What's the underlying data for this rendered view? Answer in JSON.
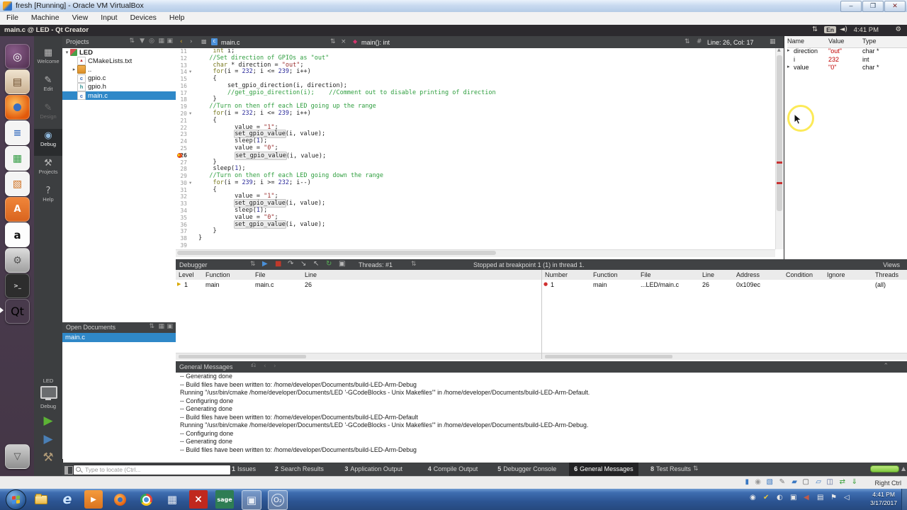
{
  "host": {
    "title": "fresh [Running] - Oracle VM VirtualBox",
    "menu": [
      "File",
      "Machine",
      "View",
      "Input",
      "Devices",
      "Help"
    ],
    "window_buttons": [
      "minimize",
      "maximize",
      "close"
    ],
    "status_shortcut": "Right Ctrl",
    "status_icons": [
      "hdd",
      "optical-disk",
      "audio",
      "pen",
      "shared-folder",
      "display",
      "folders",
      "usb",
      "network-arrows",
      "download"
    ],
    "taskbar": {
      "clock_time": "4:41 PM",
      "clock_date": "3/17/2017",
      "icons": [
        {
          "name": "explorer"
        },
        {
          "name": "internet-explorer",
          "glyph": "e"
        },
        {
          "name": "media-player",
          "glyph": "▶"
        },
        {
          "name": "firefox"
        },
        {
          "name": "chrome"
        },
        {
          "name": "calculator",
          "glyph": "▦"
        },
        {
          "name": "x-app",
          "glyph": "×"
        },
        {
          "name": "sage",
          "label": "sage"
        },
        {
          "name": "virtualbox",
          "glyph": "▣",
          "active": true
        },
        {
          "name": "o2-app",
          "label": "O₂",
          "active": true
        }
      ],
      "tray": [
        {
          "name": "bluetooth",
          "glyph": "◉"
        },
        {
          "name": "security-shield",
          "glyph": "✔"
        },
        {
          "name": "updates",
          "glyph": "◐"
        },
        {
          "name": "display",
          "glyph": "▣"
        },
        {
          "name": "audio-device",
          "glyph": "◀"
        },
        {
          "name": "network",
          "glyph": "▤"
        },
        {
          "name": "action-center-flag",
          "glyph": "⚑"
        },
        {
          "name": "volume",
          "glyph": "◁"
        }
      ]
    }
  },
  "guest_panel": {
    "title": "main.c @ LED - Qt Creator",
    "keyboard": "En",
    "time": "4:41 PM",
    "icons": [
      "network-arrows",
      "keyboard-layout",
      "volume",
      "clock",
      "session-gear"
    ]
  },
  "launcher": {
    "items": [
      {
        "name": "dash",
        "glyph": "◎"
      },
      {
        "name": "files",
        "glyph": "▤"
      },
      {
        "name": "firefox",
        "glyph": ""
      },
      {
        "name": "writer",
        "glyph": "≡"
      },
      {
        "name": "calc",
        "glyph": "▦"
      },
      {
        "name": "impress",
        "glyph": "▧"
      },
      {
        "name": "software",
        "glyph": "A"
      },
      {
        "name": "amazon",
        "glyph": "a"
      },
      {
        "name": "settings",
        "glyph": "⚙"
      },
      {
        "name": "terminal",
        "glyph": ">_"
      },
      {
        "name": "qtcreator",
        "glyph": "Qt",
        "running": true
      },
      {
        "name": "trash",
        "glyph": "▽"
      }
    ]
  },
  "modebar": {
    "items": [
      {
        "label": "Welcome",
        "icon": "▦"
      },
      {
        "label": "Edit",
        "icon": "✎"
      },
      {
        "label": "Design",
        "icon": "✎",
        "disabled": true
      },
      {
        "label": "Debug",
        "icon": "◉",
        "active": true
      },
      {
        "label": "Projects",
        "icon": "⚒"
      },
      {
        "label": "Help",
        "icon": "?"
      }
    ],
    "kit": {
      "project": "LED",
      "config": "Debug"
    },
    "run_buttons": [
      {
        "name": "run",
        "glyph": "▶",
        "color": "#5cb335"
      },
      {
        "name": "start-debugging",
        "glyph": "▶",
        "color": "#4a7fb5"
      },
      {
        "name": "build",
        "glyph": "⚒",
        "color": "#b09a77"
      }
    ]
  },
  "projects": {
    "header": "Projects",
    "header_icons": [
      "combo-arrows",
      "filter",
      "link",
      "split",
      "close-split"
    ],
    "tree": [
      {
        "label": "LED",
        "depth": 0,
        "icon": "project",
        "bold": true,
        "expander": "▾"
      },
      {
        "label": "CMakeLists.txt",
        "depth": 1,
        "icon": "doc"
      },
      {
        "label": "..",
        "depth": 1,
        "icon": "folder",
        "expander": "▸"
      },
      {
        "label": "gpio.c",
        "depth": 1,
        "icon": "c"
      },
      {
        "label": "gpio.h",
        "depth": 1,
        "icon": "h"
      },
      {
        "label": "main.c",
        "depth": 1,
        "icon": "c",
        "selected": true
      }
    ]
  },
  "open_documents": {
    "header": "Open Documents",
    "header_icons": [
      "combo-arrows",
      "split",
      "close-split"
    ],
    "items": [
      {
        "label": "main.c",
        "selected": true
      }
    ]
  },
  "editor": {
    "breadcrumb": {
      "back": "‹",
      "forward": "›",
      "file": "main.c",
      "symbol": "main(): int",
      "line_col": "Line: 26, Col: 17"
    },
    "breakpoint_line": 26,
    "lines": [
      {
        "n": 11,
        "segs": [
          [
            "p",
            "    "
          ],
          [
            "k",
            "int"
          ],
          [
            "p",
            " i;"
          ]
        ]
      },
      {
        "n": 12,
        "segs": [
          [
            "p",
            "   "
          ],
          [
            "c",
            "//Set direction of GPIOs as \"out\""
          ]
        ]
      },
      {
        "n": 13,
        "segs": [
          [
            "p",
            "    "
          ],
          [
            "k",
            "char"
          ],
          [
            "p",
            " * direction = "
          ],
          [
            "s",
            "\"out\""
          ],
          [
            "p",
            ";"
          ]
        ]
      },
      {
        "n": 14,
        "fold": true,
        "segs": [
          [
            "p",
            "    "
          ],
          [
            "k",
            "for"
          ],
          [
            "p",
            "(i = "
          ],
          [
            "n2",
            "232"
          ],
          [
            "p",
            "; i <= "
          ],
          [
            "n2",
            "239"
          ],
          [
            "p",
            "; i++)"
          ]
        ]
      },
      {
        "n": 15,
        "segs": [
          [
            "p",
            "    {"
          ]
        ]
      },
      {
        "n": 16,
        "segs": [
          [
            "p",
            "        set_gpio_direction(i, direction);"
          ]
        ]
      },
      {
        "n": 17,
        "segs": [
          [
            "p",
            "        "
          ],
          [
            "c",
            "//get_gpio_direction(i);    //Comment out to disable printing of direction"
          ]
        ]
      },
      {
        "n": 18,
        "segs": [
          [
            "p",
            "    }"
          ]
        ]
      },
      {
        "n": 19,
        "segs": [
          [
            "p",
            "   "
          ],
          [
            "c",
            "//Turn on then off each LED going up the range"
          ]
        ]
      },
      {
        "n": 20,
        "fold": true,
        "segs": [
          [
            "p",
            "    "
          ],
          [
            "k",
            "for"
          ],
          [
            "p",
            "(i = "
          ],
          [
            "n2",
            "232"
          ],
          [
            "p",
            "; i <= "
          ],
          [
            "n2",
            "239"
          ],
          [
            "p",
            "; i++)"
          ]
        ]
      },
      {
        "n": 21,
        "segs": [
          [
            "p",
            "    {"
          ]
        ]
      },
      {
        "n": 22,
        "segs": [
          [
            "p",
            "          value = "
          ],
          [
            "s",
            "\"1\""
          ],
          [
            "p",
            ";"
          ]
        ]
      },
      {
        "n": 23,
        "segs": [
          [
            "p",
            "          "
          ],
          [
            "f",
            "set_gpio_value"
          ],
          [
            "p",
            "(i, value);"
          ]
        ]
      },
      {
        "n": 24,
        "segs": [
          [
            "p",
            "          sleep("
          ],
          [
            "n2",
            "1"
          ],
          [
            "p",
            ");"
          ]
        ]
      },
      {
        "n": 25,
        "segs": [
          [
            "p",
            "          value = "
          ],
          [
            "s",
            "\"0\""
          ],
          [
            "p",
            ";"
          ]
        ]
      },
      {
        "n": 26,
        "bp": true,
        "segs": [
          [
            "p",
            "          "
          ],
          [
            "caret",
            ""
          ],
          [
            "f",
            "set_gpio_value"
          ],
          [
            "p",
            "(i, value);"
          ]
        ]
      },
      {
        "n": 27,
        "segs": [
          [
            "p",
            "    }"
          ]
        ]
      },
      {
        "n": 28,
        "segs": [
          [
            "p",
            "    sleep("
          ],
          [
            "n2",
            "1"
          ],
          [
            "p",
            ");"
          ]
        ]
      },
      {
        "n": 29,
        "segs": [
          [
            "p",
            "   "
          ],
          [
            "c",
            "//Turn on then off each LED going down the range"
          ]
        ]
      },
      {
        "n": 30,
        "fold": true,
        "segs": [
          [
            "p",
            "    "
          ],
          [
            "k",
            "for"
          ],
          [
            "p",
            "(i = "
          ],
          [
            "n2",
            "239"
          ],
          [
            "p",
            "; i >= "
          ],
          [
            "n2",
            "232"
          ],
          [
            "p",
            "; i--)"
          ]
        ]
      },
      {
        "n": 31,
        "segs": [
          [
            "p",
            "    {"
          ]
        ]
      },
      {
        "n": 32,
        "segs": [
          [
            "p",
            "          value = "
          ],
          [
            "s",
            "\"1\""
          ],
          [
            "p",
            ";"
          ]
        ]
      },
      {
        "n": 33,
        "segs": [
          [
            "p",
            "          "
          ],
          [
            "f",
            "set_gpio_value"
          ],
          [
            "p",
            "(i, value);"
          ]
        ]
      },
      {
        "n": 34,
        "segs": [
          [
            "p",
            "          sleep("
          ],
          [
            "n2",
            "1"
          ],
          [
            "p",
            ");"
          ]
        ]
      },
      {
        "n": 35,
        "segs": [
          [
            "p",
            "          value = "
          ],
          [
            "s",
            "\"0\""
          ],
          [
            "p",
            ";"
          ]
        ]
      },
      {
        "n": 36,
        "segs": [
          [
            "p",
            "          "
          ],
          [
            "f",
            "set_gpio_value"
          ],
          [
            "p",
            "(i, value);"
          ]
        ]
      },
      {
        "n": 37,
        "segs": [
          [
            "p",
            "    }"
          ]
        ]
      },
      {
        "n": 38,
        "segs": [
          [
            "p",
            "}"
          ]
        ]
      },
      {
        "n": 39,
        "segs": []
      }
    ]
  },
  "locals": {
    "columns": [
      "Name",
      "Value",
      "Type"
    ],
    "rows": [
      {
        "name": "direction",
        "value": "\"out\"",
        "type": "char *",
        "expandable": true
      },
      {
        "name": "i",
        "value": "232",
        "type": "int",
        "expandable": false
      },
      {
        "name": "value",
        "value": "\"0\"",
        "type": "char *",
        "expandable": true
      }
    ]
  },
  "debugger": {
    "title": "Debugger",
    "threads": "Threads: #1",
    "status": "Stopped at breakpoint 1 (1) in thread 1.",
    "views_label": "Views",
    "toolbar": [
      {
        "name": "continue",
        "glyph": "▶",
        "color": "#4a90d9"
      },
      {
        "name": "stop",
        "glyph": "■",
        "color": "#c0392b"
      },
      {
        "name": "step-over",
        "glyph": "↷",
        "color": "#b8b8b8"
      },
      {
        "name": "step-into",
        "glyph": "↘",
        "color": "#b8b8b8"
      },
      {
        "name": "step-out",
        "glyph": "↖",
        "color": "#b8b8b8"
      },
      {
        "name": "restart",
        "glyph": "↻",
        "color": "#58b158"
      },
      {
        "name": "detach",
        "glyph": "▣",
        "color": "#b8b8b8"
      }
    ],
    "stack": {
      "columns": [
        "Level",
        "Function",
        "File",
        "Line"
      ],
      "rows": [
        [
          "1",
          "main",
          "main.c",
          "26"
        ]
      ]
    },
    "breakpoints": {
      "columns": [
        "Number",
        "Function",
        "File",
        "Line",
        "Address",
        "Condition",
        "Ignore",
        "Threads"
      ],
      "rows": [
        [
          "1",
          "main",
          "...LED/main.c",
          "26",
          "0x109ec",
          "",
          "",
          "(all)"
        ]
      ]
    }
  },
  "general_messages": {
    "header": "General Messages",
    "header_icons": [
      "clear",
      "prev",
      "next",
      "collapse"
    ],
    "lines": [
      "-- Generating done",
      "-- Build files have been written to: /home/developer/Documents/build-LED-Arm-Debug",
      "Running \"/usr/bin/cmake /home/developer/Documents/LED '-GCodeBlocks - Unix Makefiles'\" in /home/developer/Documents/build-LED-Arm-Default.",
      "-- Configuring done",
      "-- Generating done",
      "-- Build files have been written to: /home/developer/Documents/build-LED-Arm-Default",
      "Running \"/usr/bin/cmake /home/developer/Documents/LED '-GCodeBlocks - Unix Makefiles'\" in /home/developer/Documents/build-LED-Arm-Debug.",
      "-- Configuring done",
      "-- Generating done",
      "-- Build files have been written to: /home/developer/Documents/build-LED-Arm-Debug"
    ]
  },
  "output_bar": {
    "locator_placeholder": "Type to locate (Ctrl...",
    "panes": [
      {
        "num": "1",
        "label": "Issues"
      },
      {
        "num": "2",
        "label": "Search Results"
      },
      {
        "num": "3",
        "label": "Application Output"
      },
      {
        "num": "4",
        "label": "Compile Output"
      },
      {
        "num": "5",
        "label": "Debugger Console"
      },
      {
        "num": "6",
        "label": "General Messages",
        "active": true
      },
      {
        "num": "8",
        "label": "Test Results"
      }
    ]
  }
}
